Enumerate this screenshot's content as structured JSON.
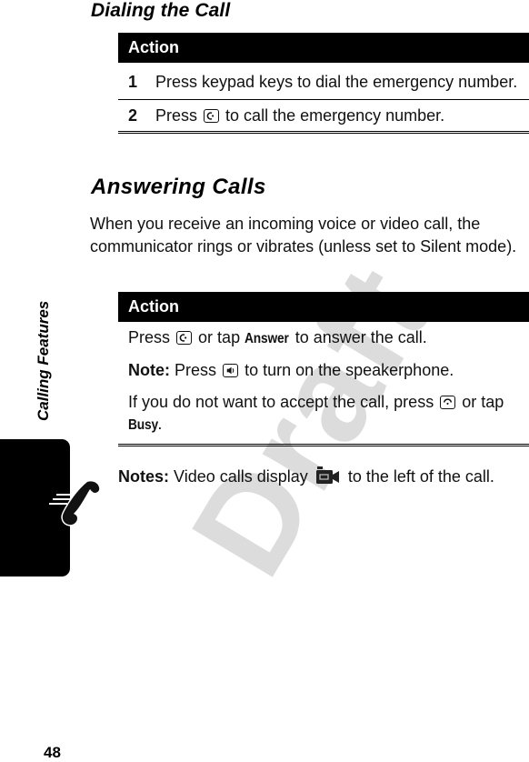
{
  "watermark": "Draft",
  "side_tab": {
    "label": "Calling Features",
    "icon": "phone-handset-icon"
  },
  "page_number": "48",
  "sections": {
    "dialing": {
      "title": "Dialing the Call",
      "table": {
        "header": "Action",
        "rows": [
          {
            "num": "1",
            "text": "Press keypad keys to dial the emergency number."
          },
          {
            "num": "2",
            "text_before": "Press",
            "key_icon": "send-key-icon",
            "text_after": "to call the emergency number."
          }
        ]
      }
    },
    "answering": {
      "title": "Answering Calls",
      "intro": "When you receive an incoming voice or video call, the communicator rings or vibrates (unless set to Silent mode).",
      "table": {
        "header": "Action",
        "rows": [
          {
            "text_before": "Press",
            "key_icon": "send-key-icon",
            "text_mid": "or tap",
            "ui_label": "Answer",
            "text_after": "to answer the call."
          },
          {
            "label": "Note:",
            "text_before": "Press",
            "key_icon": "speaker-key-icon",
            "text_after": "to turn on the speakerphone."
          },
          {
            "text_before": "If you do not want to accept the call, press",
            "key_icon": "end-key-icon",
            "text_mid": "or tap",
            "ui_label": "Busy",
            "text_after": "."
          }
        ]
      },
      "notes": {
        "label": "Notes:",
        "text_before": "Video calls display",
        "icon": "video-camera-icon",
        "text_after": "to the left of the call."
      }
    }
  }
}
